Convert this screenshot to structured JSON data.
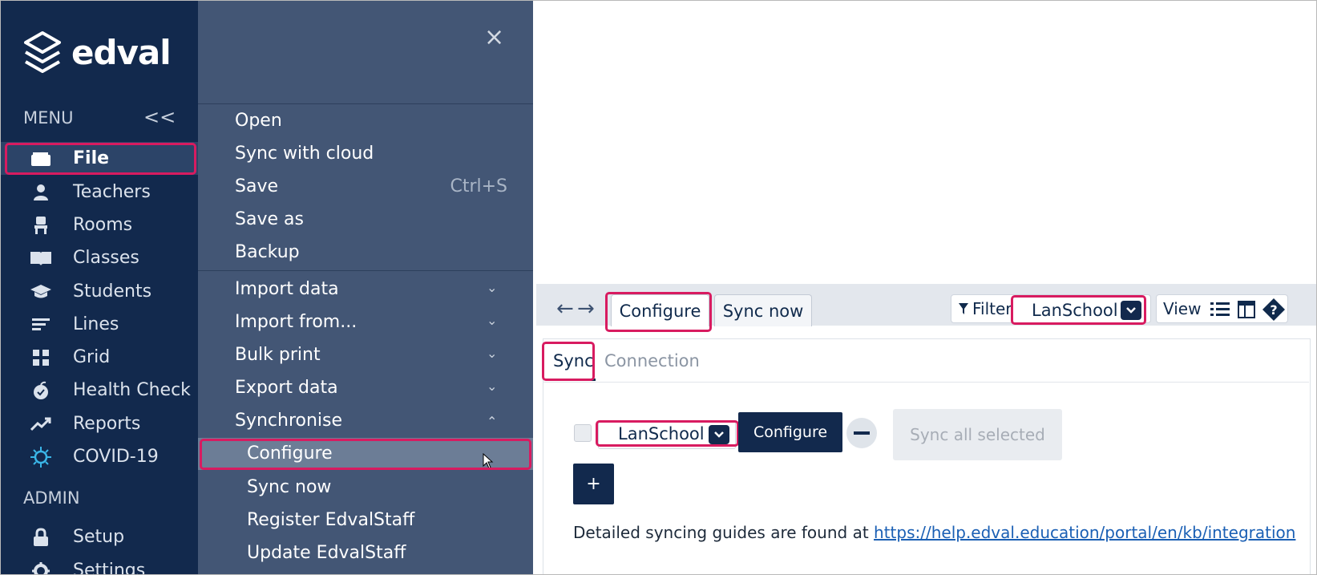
{
  "app": {
    "brand": "edval",
    "menu_label": "MENU",
    "admin_label": "ADMIN",
    "collapse_label": "<<"
  },
  "sidebar": {
    "items": [
      {
        "label": "File",
        "icon": "folder-icon"
      },
      {
        "label": "Teachers",
        "icon": "person-icon"
      },
      {
        "label": "Rooms",
        "icon": "chair-icon"
      },
      {
        "label": "Classes",
        "icon": "book-icon"
      },
      {
        "label": "Students",
        "icon": "graduation-cap-icon"
      },
      {
        "label": "Lines",
        "icon": "lines-icon"
      },
      {
        "label": "Grid",
        "icon": "grid-icon"
      },
      {
        "label": "Health Check",
        "icon": "apple-icon"
      },
      {
        "label": "Reports",
        "icon": "trend-icon"
      },
      {
        "label": "COVID-19",
        "icon": "virus-icon"
      }
    ],
    "admin_items": [
      {
        "label": "Setup",
        "icon": "lock-icon"
      },
      {
        "label": "Settings",
        "icon": "gear-icon"
      }
    ]
  },
  "file_menu": {
    "close": "×",
    "items": {
      "open": "Open",
      "sync_cloud": "Sync with cloud",
      "save": "Save",
      "save_shortcut": "Ctrl+S",
      "save_as": "Save as",
      "backup": "Backup",
      "import_data": "Import data",
      "import_from": "Import from...",
      "bulk_print": "Bulk print",
      "export_data": "Export data",
      "synchronise": "Synchronise",
      "configure": "Configure",
      "sync_now": "Sync now",
      "register": "Register EdvalStaff",
      "update": "Update EdvalStaff"
    }
  },
  "toolbar": {
    "tabs": [
      "Configure",
      "Sync now"
    ],
    "filter_label": "Filter",
    "filter_value": "LanSchool",
    "view_label": "View"
  },
  "sync_panel": {
    "subtabs": [
      "Sync",
      "Connection"
    ],
    "integration_value": "LanSchool",
    "configure_label": "Configure",
    "sync_all_label": "Sync all selected",
    "add_label": "+",
    "guide_text": "Detailed syncing guides are found at",
    "guide_link": "https://help.edval.education/portal/en/kb/integration"
  },
  "colors": {
    "sidebar_bg": "#12294d",
    "flyout_bg": "#435675",
    "highlight": "#d81b60",
    "link": "#1a5fb4"
  }
}
